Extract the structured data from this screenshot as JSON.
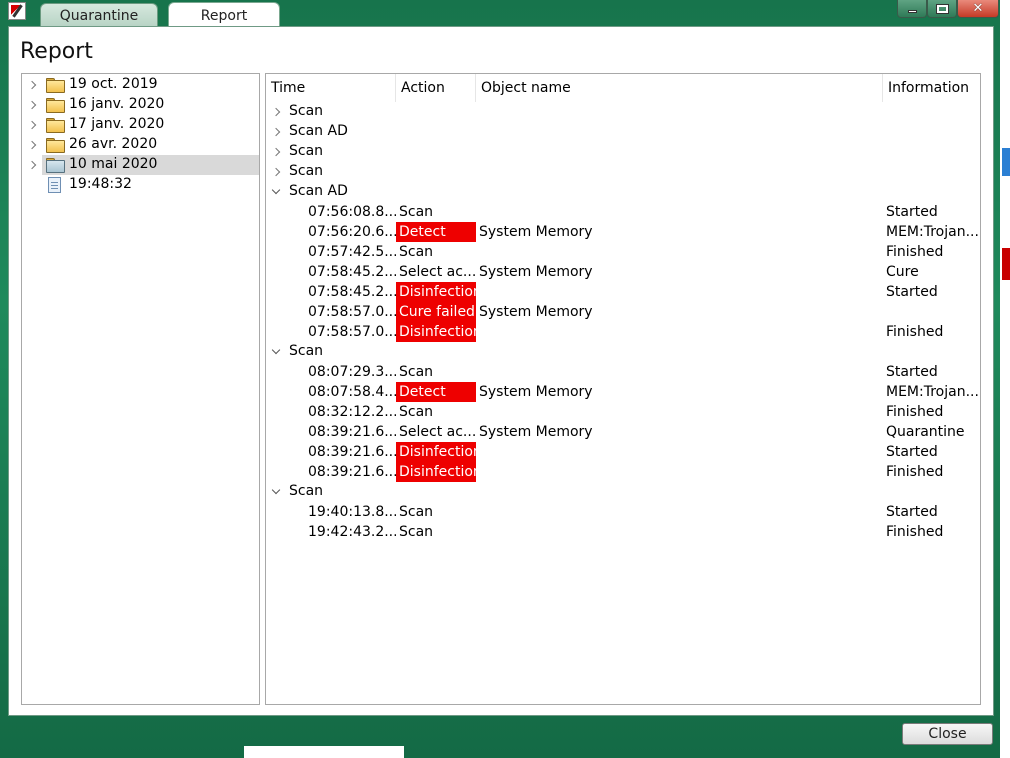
{
  "window": {
    "tabs": [
      "Quarantine",
      "Report"
    ],
    "active_tab": "Report"
  },
  "page": {
    "title": "Report"
  },
  "tree": [
    {
      "label": "19 oct. 2019",
      "expanded": false,
      "type": "folder"
    },
    {
      "label": "16 janv. 2020",
      "expanded": false,
      "type": "folder"
    },
    {
      "label": "17 janv. 2020",
      "expanded": false,
      "type": "folder"
    },
    {
      "label": "26 avr. 2020",
      "expanded": false,
      "type": "folder"
    },
    {
      "label": "10 mai 2020",
      "expanded": false,
      "type": "folder",
      "selected": true
    },
    {
      "label": "19:48:32",
      "type": "file"
    }
  ],
  "columns": [
    "Time",
    "Action",
    "Object name",
    "Information"
  ],
  "groups": [
    {
      "label": "Scan",
      "expanded": false,
      "rows": []
    },
    {
      "label": "Scan AD",
      "expanded": false,
      "rows": []
    },
    {
      "label": "Scan",
      "expanded": false,
      "rows": []
    },
    {
      "label": "Scan",
      "expanded": false,
      "rows": []
    },
    {
      "label": "Scan AD",
      "expanded": true,
      "rows": [
        {
          "time": "07:56:08.8...",
          "action": "Scan",
          "object": "",
          "info": "Started",
          "highlight": false
        },
        {
          "time": "07:56:20.6...",
          "action": "Detect",
          "object": "System Memory",
          "info": "MEM:Trojan...",
          "highlight": true
        },
        {
          "time": "07:57:42.5...",
          "action": "Scan",
          "object": "",
          "info": "Finished",
          "highlight": false
        },
        {
          "time": "07:58:45.2...",
          "action": "Select ac...",
          "object": "System Memory",
          "info": "Cure",
          "highlight": false
        },
        {
          "time": "07:58:45.2...",
          "action": "Disinfection",
          "object": "",
          "info": "Started",
          "highlight": true
        },
        {
          "time": "07:58:57.0...",
          "action": "Cure failed",
          "object": "System Memory",
          "info": "",
          "highlight": true
        },
        {
          "time": "07:58:57.0...",
          "action": "Disinfection",
          "object": "",
          "info": "Finished",
          "highlight": true
        }
      ]
    },
    {
      "label": "Scan",
      "expanded": true,
      "rows": [
        {
          "time": "08:07:29.3...",
          "action": "Scan",
          "object": "",
          "info": "Started",
          "highlight": false
        },
        {
          "time": "08:07:58.4...",
          "action": "Detect",
          "object": "System Memory",
          "info": "MEM:Trojan...",
          "highlight": true
        },
        {
          "time": "08:32:12.2...",
          "action": "Scan",
          "object": "",
          "info": "Finished",
          "highlight": false
        },
        {
          "time": "08:39:21.6...",
          "action": "Select ac...",
          "object": "System Memory",
          "info": "Quarantine",
          "highlight": false
        },
        {
          "time": "08:39:21.6...",
          "action": "Disinfection",
          "object": "",
          "info": "Started",
          "highlight": true
        },
        {
          "time": "08:39:21.6...",
          "action": "Disinfection",
          "object": "",
          "info": "Finished",
          "highlight": true
        }
      ]
    },
    {
      "label": "Scan",
      "expanded": true,
      "rows": [
        {
          "time": "19:40:13.8...",
          "action": "Scan",
          "object": "",
          "info": "Started",
          "highlight": false
        },
        {
          "time": "19:42:43.2...",
          "action": "Scan",
          "object": "",
          "info": "Finished",
          "highlight": false
        }
      ]
    }
  ],
  "footer": {
    "close_label": "Close"
  },
  "colors": {
    "highlight": "#ee0000",
    "frame": "#1f8a5c",
    "selection": "#d9d9d9"
  }
}
